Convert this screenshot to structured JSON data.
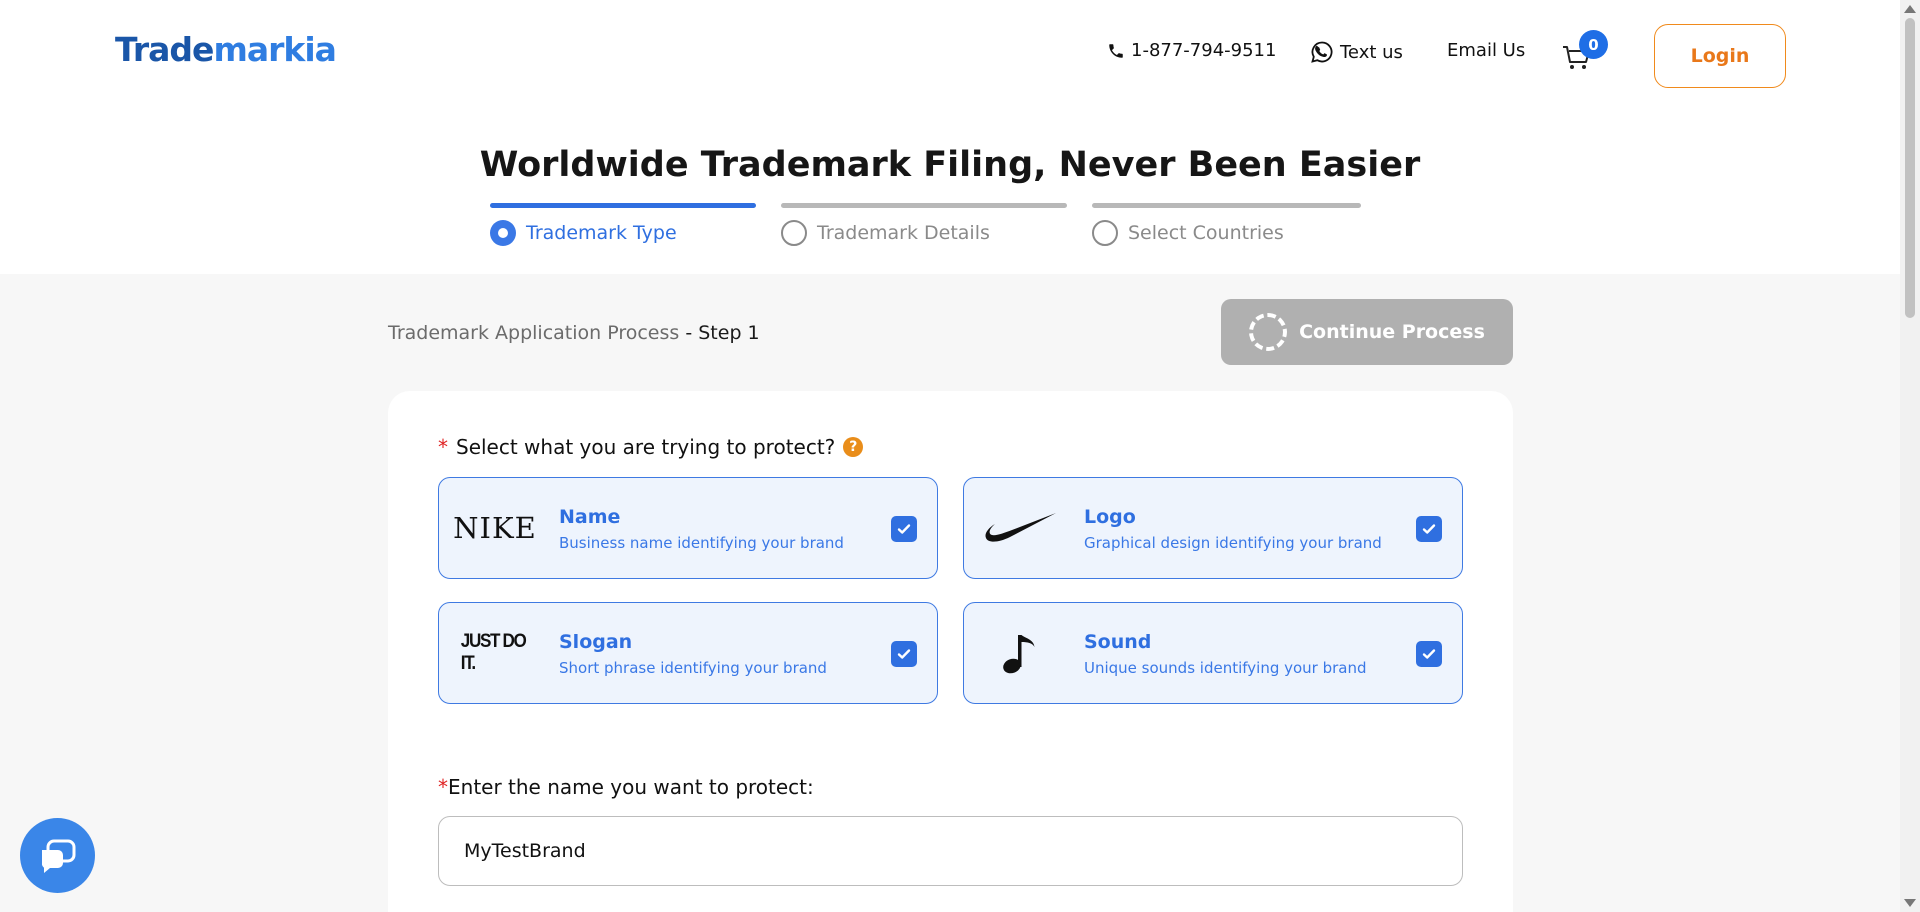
{
  "header": {
    "logo_part1": "Trade",
    "logo_part2": "markia",
    "phone": "1-877-794-9511",
    "text_us": "Text us",
    "email_us": "Email Us",
    "cart_count": "0",
    "login_label": "Login"
  },
  "page_title": "Worldwide Trademark Filing, Never Been Easier",
  "steps": [
    {
      "label": "Trademark Type",
      "active": true
    },
    {
      "label": "Trademark Details",
      "active": false
    },
    {
      "label": "Select Countries",
      "active": false
    }
  ],
  "process": {
    "breadcrumb": "Trademark Application Process",
    "step_text": " - Step 1",
    "continue_label": "Continue Process"
  },
  "form": {
    "required_mark": "*",
    "question": "Select what you are trying to protect?",
    "help_glyph": "?",
    "options": [
      {
        "image_text": "NIKE",
        "title": "Name",
        "desc": "Business name identifying your brand",
        "checked": true
      },
      {
        "image_icon": "swoosh-logo-icon",
        "title": "Logo",
        "desc": "Graphical design identifying your brand",
        "checked": true
      },
      {
        "image_text": "JUST DO IT.",
        "title": "Slogan",
        "desc": "Short phrase identifying your brand",
        "checked": true
      },
      {
        "image_icon": "music-note-icon",
        "title": "Sound",
        "desc": "Unique sounds identifying your brand",
        "checked": true
      }
    ],
    "name_label": "Enter the name you want to protect:",
    "name_value": "MyTestBrand"
  },
  "colors": {
    "brand_blue": "#2f6fe0",
    "login_orange": "#e9781a",
    "option_bg": "#eef4fd"
  }
}
